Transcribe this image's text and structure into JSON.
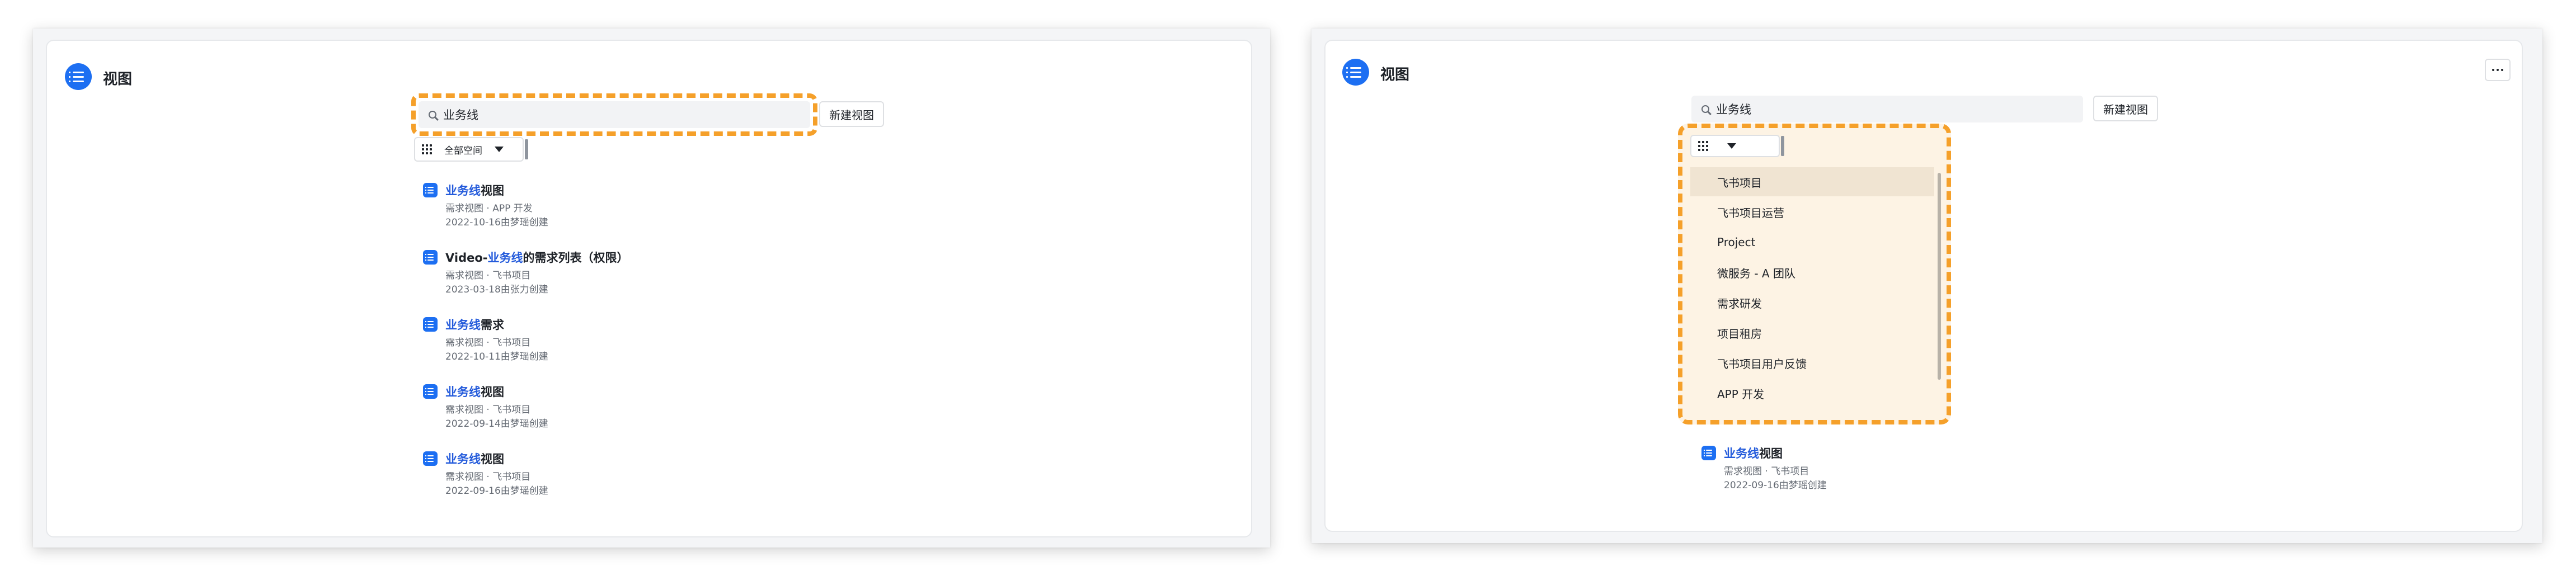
{
  "left": {
    "title": "视图",
    "search_value": "业务线",
    "new_view_label": "新建视图",
    "space_label": "全部空间",
    "results": [
      {
        "highlight": "业务线",
        "title_rest": "视图",
        "title_pre": "",
        "sub": "需求视图 · APP 开发",
        "meta": "2022-10-16由梦瑶创建"
      },
      {
        "highlight": "业务线",
        "title_rest": "的需求列表（权限）",
        "title_pre": "Video-",
        "sub": "需求视图 · 飞书项目",
        "meta": "2023-03-18由张力创建"
      },
      {
        "highlight": "业务线",
        "title_rest": "需求",
        "title_pre": "",
        "sub": "需求视图 · 飞书项目",
        "meta": "2022-10-11由梦瑶创建"
      },
      {
        "highlight": "业务线",
        "title_rest": "视图",
        "title_pre": "",
        "sub": "需求视图 · 飞书项目",
        "meta": "2022-09-14由梦瑶创建"
      },
      {
        "highlight": "业务线",
        "title_rest": "视图",
        "title_pre": "",
        "sub": "需求视图 · 飞书项目",
        "meta": "2022-09-16由梦瑶创建"
      }
    ]
  },
  "right": {
    "title": "视图",
    "search_value": "业务线",
    "new_view_label": "新建视图",
    "more_icon": "ellipsis-icon",
    "dropdown_items": [
      "飞书项目",
      "飞书项目运营",
      "Project",
      "微服务 - A 团队",
      "需求研发",
      "项目租房",
      "飞书项目用户反馈",
      "APP 开发"
    ],
    "result": {
      "highlight": "业务线",
      "title_rest": "视图",
      "sub": "需求视图 · 飞书项目",
      "meta": "2022-09-16由梦瑶创建"
    }
  },
  "colors": {
    "accent": "#1d6ff2",
    "highlight_text": "#245bdb",
    "annotation": "#f5a02a"
  }
}
